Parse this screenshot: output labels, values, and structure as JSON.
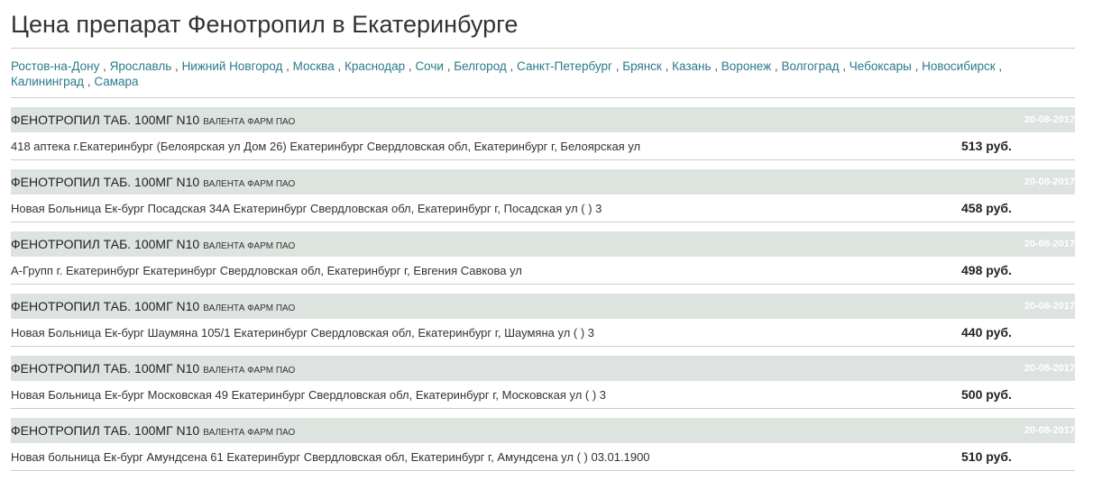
{
  "title": "Цена препарат Фенотропил в Екатеринбурге",
  "cities": [
    "Ростов-на-Дону",
    "Ярославль",
    "Нижний Новгород",
    "Москва",
    "Краснодар",
    "Сочи",
    "Белгород",
    "Санкт-Петербург",
    "Брянск",
    "Казань",
    "Воронеж",
    "Волгоград",
    "Чебоксары",
    "Новосибирск",
    "Калининград",
    "Самара"
  ],
  "offers": [
    {
      "product": "ФЕНОТРОПИЛ ТАБ. 100МГ N10",
      "manufacturer": "ВАЛЕНТА ФАРМ ПАО",
      "date": "20-08-2017",
      "pharmacy": "418 аптека г.Екатеринбург (Белоярская ул Дом 26) Екатеринбург Свердловская обл, Екатеринбург г, Белоярская ул",
      "price": "513 руб."
    },
    {
      "product": "ФЕНОТРОПИЛ ТАБ. 100МГ N10",
      "manufacturer": "ВАЛЕНТА ФАРМ ПАО",
      "date": "20-08-2017",
      "pharmacy": "Новая Больница Ек-бург Посадская 34А Екатеринбург Свердловская обл, Екатеринбург г, Посадская ул ( ) 3",
      "price": "458 руб."
    },
    {
      "product": "ФЕНОТРОПИЛ ТАБ. 100МГ N10",
      "manufacturer": "ВАЛЕНТА ФАРМ ПАО",
      "date": "20-08-2017",
      "pharmacy": "А-Групп г. Екатеринбург Екатеринбург Свердловская обл, Екатеринбург г, Евгения Савкова ул",
      "price": "498 руб."
    },
    {
      "product": "ФЕНОТРОПИЛ ТАБ. 100МГ N10",
      "manufacturer": "ВАЛЕНТА ФАРМ ПАО",
      "date": "20-08-2017",
      "pharmacy": "Новая Больница Ек-бург Шаумяна 105/1 Екатеринбург Свердловская обл, Екатеринбург г, Шаумяна ул ( ) 3",
      "price": "440 руб."
    },
    {
      "product": "ФЕНОТРОПИЛ ТАБ. 100МГ N10",
      "manufacturer": "ВАЛЕНТА ФАРМ ПАО",
      "date": "20-08-2017",
      "pharmacy": "Новая Больница Ек-бург Московская 49 Екатеринбург Свердловская обл, Екатеринбург г, Московская ул ( ) 3",
      "price": "500 руб."
    },
    {
      "product": "ФЕНОТРОПИЛ ТАБ. 100МГ N10",
      "manufacturer": "ВАЛЕНТА ФАРМ ПАО",
      "date": "20-08-2017",
      "pharmacy": "Новая больница Ек-бург Амундсена 61 Екатеринбург Свердловская обл, Екатеринбург г, Амундсена ул ( ) 03.01.1900",
      "price": "510 руб."
    }
  ]
}
